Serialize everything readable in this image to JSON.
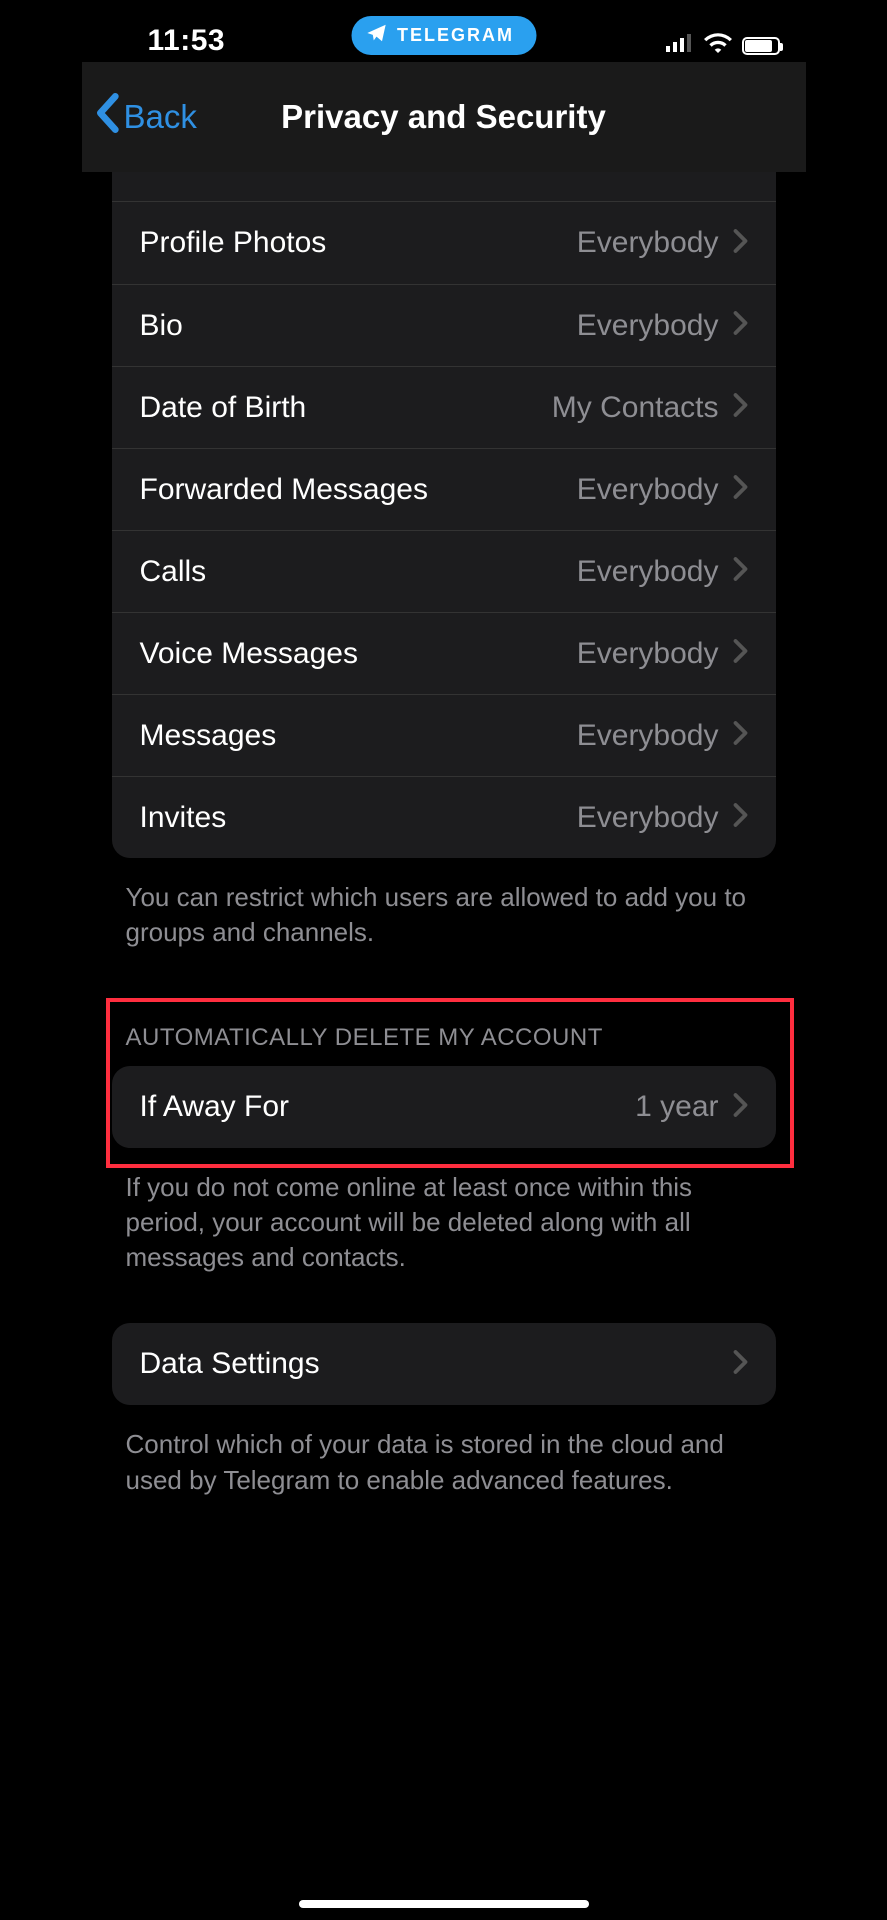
{
  "statusbar": {
    "time": "11:53",
    "pill_label": "TELEGRAM"
  },
  "nav": {
    "back": "Back",
    "title": "Privacy and Security"
  },
  "privacy_items": [
    {
      "label": "Profile Photos",
      "value": "Everybody"
    },
    {
      "label": "Bio",
      "value": "Everybody"
    },
    {
      "label": "Date of Birth",
      "value": "My Contacts"
    },
    {
      "label": "Forwarded Messages",
      "value": "Everybody"
    },
    {
      "label": "Calls",
      "value": "Everybody"
    },
    {
      "label": "Voice Messages",
      "value": "Everybody"
    },
    {
      "label": "Messages",
      "value": "Everybody"
    },
    {
      "label": "Invites",
      "value": "Everybody"
    }
  ],
  "privacy_footer": "You can restrict which users are allowed to add you to groups and channels.",
  "delete_section": {
    "header": "AUTOMATICALLY DELETE MY ACCOUNT",
    "row_label": "If Away For",
    "row_value": "1 year",
    "footer": "If you do not come online at least once within this period, your account will be deleted along with all messages and contacts."
  },
  "data_section": {
    "row_label": "Data Settings",
    "footer": "Control which of your data is stored in the cloud and used by Telegram to enable advanced features."
  }
}
